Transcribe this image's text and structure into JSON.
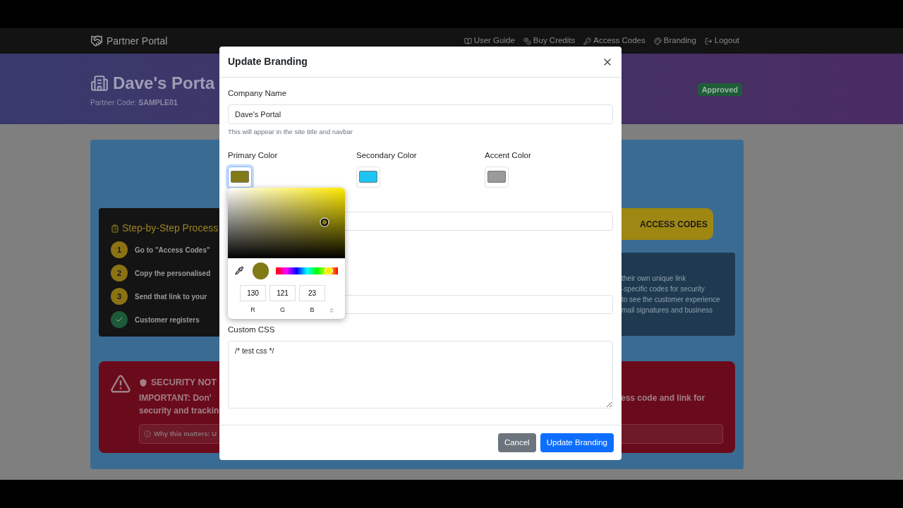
{
  "navbar": {
    "brand": "Partner Portal",
    "links": [
      {
        "label": "User Guide"
      },
      {
        "label": "Buy Credits"
      },
      {
        "label": "Access Codes"
      },
      {
        "label": "Branding"
      },
      {
        "label": "Logout"
      }
    ]
  },
  "header": {
    "title": "Dave's Porta",
    "partner_code": "Partner Code: **SAMPLE01**",
    "status": "Approved"
  },
  "steps_card": {
    "title": "Step-by-Step Process",
    "steps": [
      {
        "kind": "number",
        "marker": "1",
        "text": "Go to \"Access Codes\""
      },
      {
        "kind": "number",
        "marker": "2",
        "text": "Copy the personalised"
      },
      {
        "kind": "number",
        "marker": "3",
        "text": "Send that link to your"
      },
      {
        "kind": "done",
        "text": "Customer registers"
      }
    ]
  },
  "access_codes_button": "ACCESS CODES",
  "info_lines": [
    "their own unique link",
    "-specific codes for security",
    "to see the customer experience",
    "mail signatures and business"
  ],
  "security_notice": {
    "title": "SECURITY NOT",
    "line_left": "**IMPORTANT:** Don'",
    "line_right": "ess code and link for",
    "line_2": "security and trackin",
    "why": "Why this matters: U"
  },
  "modal": {
    "title": "Update Branding",
    "company_name": {
      "label": "Company Name",
      "value": "Dave's Portal",
      "help": "This will appear in the site title and navbar"
    },
    "colors": [
      {
        "label": "Primary Color",
        "color": "#827917",
        "selected": true
      },
      {
        "label": "Secondary Color",
        "color": "#1fc4f2",
        "selected": false
      },
      {
        "label": "Accent Color",
        "color": "#9a9a9a",
        "selected": false
      }
    ],
    "picker": {
      "r": "130",
      "g": "121",
      "b": "23",
      "labels": [
        "R",
        "G",
        "B"
      ]
    },
    "custom_css": {
      "label": "Custom CSS",
      "value": "/* test css */"
    },
    "buttons": [
      {
        "label": "Cancel",
        "kind": "secondary"
      },
      {
        "label": "Update Branding",
        "kind": "primary"
      }
    ]
  }
}
